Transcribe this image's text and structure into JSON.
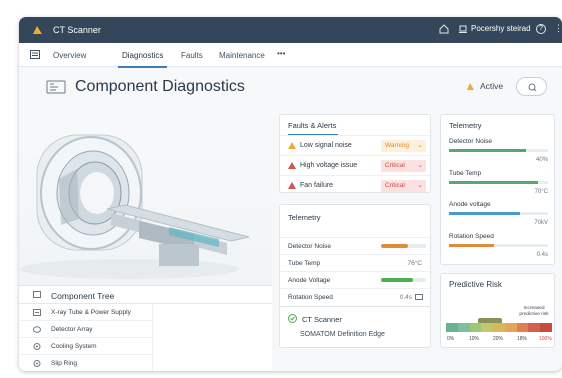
{
  "app": {
    "title": "CT Scanner",
    "user": "Pocershy steirad",
    "help": "?",
    "more": "⋮"
  },
  "nav": {
    "items": [
      "Overview",
      "Diagnostics",
      "Faults",
      "Maintenance",
      "•••"
    ]
  },
  "header": {
    "title": "Component Diagnostics",
    "status": "Active"
  },
  "tree": {
    "title": "Component Tree",
    "items": [
      "X-ray Tube & Power Supply",
      "Detector Array",
      "Cooling System",
      "Slip Ring"
    ]
  },
  "faults": {
    "title": "Faults & Alerts",
    "items": [
      {
        "label": "Low signal noise",
        "severity": "Warning",
        "color": "#f5a623"
      },
      {
        "label": "High voltage issue",
        "severity": "Critical",
        "color": "#d9534f"
      },
      {
        "label": "Fan failure",
        "severity": "Critical",
        "color": "#d9534f"
      }
    ]
  },
  "telemetry_left": {
    "title": "Telemetry",
    "items": [
      {
        "label": "Detector Noise",
        "value": "",
        "level": 0.6,
        "color": "#e08a3c"
      },
      {
        "label": "Tube Temp",
        "value": "76°C",
        "level": null,
        "color": ""
      },
      {
        "label": "Anode Voltage",
        "value": "",
        "level": 0.7,
        "color": "#4caf50"
      },
      {
        "label": "Rotation Speed",
        "value": "0.4s",
        "level": null,
        "color": ""
      }
    ]
  },
  "ct_card": {
    "title": "CT Scanner",
    "model": "SOMATOM Definition Edge"
  },
  "telemetry_right": {
    "title": "Telemetry",
    "items": [
      {
        "label": "Detector Noise",
        "value": "40%",
        "level": 0.78,
        "color": "#5aa86e"
      },
      {
        "label": "Tube Temp",
        "value": "70°C",
        "level": 0.9,
        "color": "#5aa86e"
      },
      {
        "label": "Anode voltage",
        "value": "70kV",
        "level": 0.72,
        "color": "#4a9bc9"
      },
      {
        "label": "Rotation Speed",
        "value": "0.4s",
        "level": 0.45,
        "color": "#e08a3c"
      }
    ]
  },
  "risk": {
    "title": "Predictive Risk",
    "increase_label": "Increased predictive risk",
    "labels": [
      "0%",
      "10%",
      "20%",
      "18%",
      "100%"
    ],
    "colors": [
      "#6bb38e",
      "#7fbf9a",
      "#9ec67a",
      "#c3c76b",
      "#d9b85c",
      "#e6a35a",
      "#e0804f",
      "#d45f4a",
      "#c94a43"
    ]
  }
}
